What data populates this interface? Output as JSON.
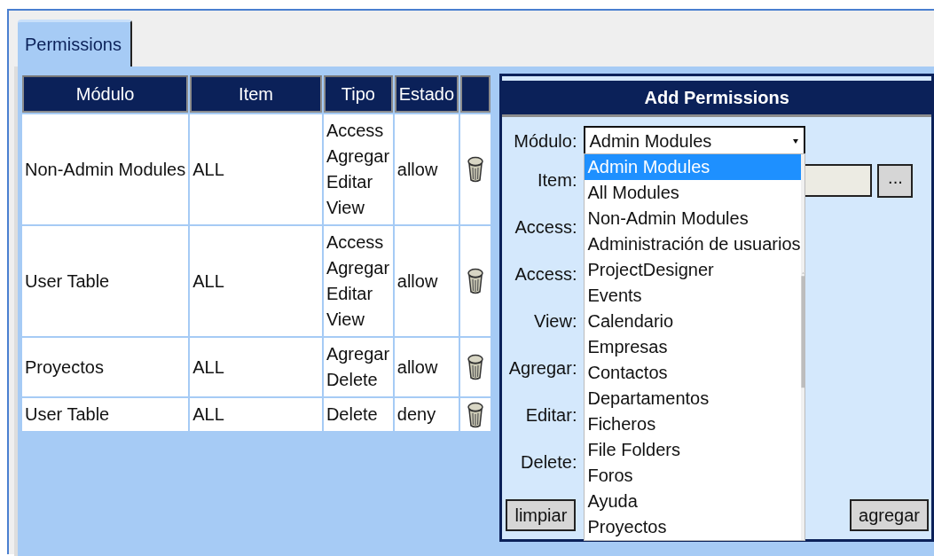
{
  "tabs": [
    {
      "label": "Permissions",
      "selected": true
    }
  ],
  "table": {
    "columns": [
      "Módulo",
      "Item",
      "Tipo",
      "Estado",
      ""
    ],
    "rows": [
      {
        "module": "Non-Admin Modules",
        "item": "ALL",
        "types": [
          "Access",
          "Agregar",
          "Editar",
          "View"
        ],
        "state": "allow"
      },
      {
        "module": "User Table",
        "item": "ALL",
        "types": [
          "Access",
          "Agregar",
          "Editar",
          "View"
        ],
        "state": "allow"
      },
      {
        "module": "Proyectos",
        "item": "ALL",
        "types": [
          "Agregar",
          "Delete"
        ],
        "state": "allow"
      },
      {
        "module": "User Table",
        "item": "ALL",
        "types": [
          "Delete"
        ],
        "state": "deny"
      }
    ]
  },
  "add_permissions": {
    "title": "Add Permissions",
    "fields": [
      {
        "label": "Módulo:",
        "kind": "select"
      },
      {
        "label": "Item:",
        "kind": "lookup",
        "button": "..."
      },
      {
        "label": "Access:",
        "kind": "flag"
      },
      {
        "label": "Access:",
        "kind": "flag"
      },
      {
        "label": "View:",
        "kind": "flag"
      },
      {
        "label": "Agregar:",
        "kind": "flag"
      },
      {
        "label": "Editar:",
        "kind": "flag"
      },
      {
        "label": "Delete:",
        "kind": "flag"
      }
    ],
    "module_select": {
      "value": "Admin Modules",
      "expanded": true,
      "options": [
        {
          "label": "Admin Modules",
          "selected": true
        },
        {
          "label": "All Modules",
          "selected": false
        },
        {
          "label": "Non-Admin Modules",
          "selected": false
        },
        {
          "label": "Administración de usuarios",
          "selected": false
        },
        {
          "label": "ProjectDesigner",
          "selected": false
        },
        {
          "label": "Events",
          "selected": false
        },
        {
          "label": "Calendario",
          "selected": false
        },
        {
          "label": "Empresas",
          "selected": false
        },
        {
          "label": "Contactos",
          "selected": false
        },
        {
          "label": "Departamentos",
          "selected": false
        },
        {
          "label": "Ficheros",
          "selected": false
        },
        {
          "label": "File Folders",
          "selected": false
        },
        {
          "label": "Foros",
          "selected": false
        },
        {
          "label": "Ayuda",
          "selected": false
        },
        {
          "label": "Proyectos",
          "selected": false
        }
      ]
    },
    "buttons": [
      {
        "label": "limpiar"
      },
      {
        "label": "agregar"
      }
    ]
  }
}
